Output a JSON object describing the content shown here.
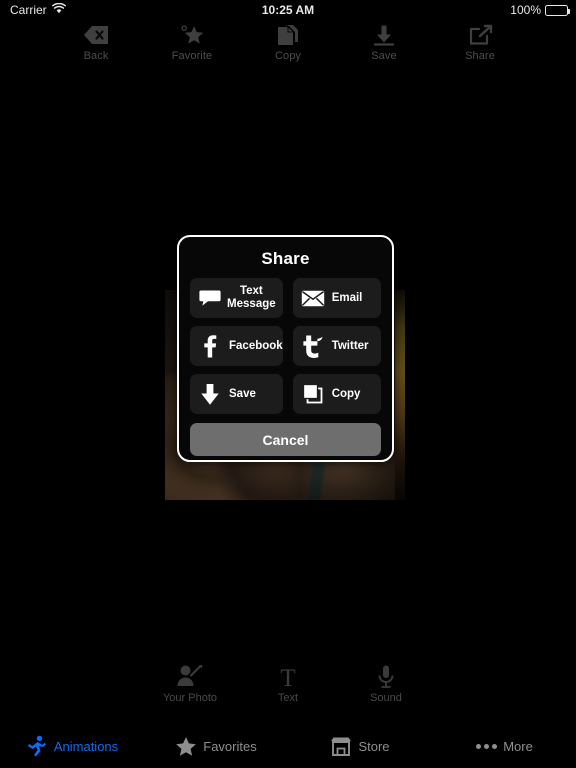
{
  "status_bar": {
    "carrier": "Carrier",
    "wifi_icon": "wifi-icon",
    "time": "10:25 AM",
    "battery_percent": "100%",
    "battery_icon": "battery-full-icon"
  },
  "top_toolbar": {
    "items": [
      {
        "label": "Back",
        "icon": "back-x-icon"
      },
      {
        "label": "Favorite",
        "icon": "star-plus-icon"
      },
      {
        "label": "Copy",
        "icon": "copy-pages-icon"
      },
      {
        "label": "Save",
        "icon": "download-arrow-icon"
      },
      {
        "label": "Share",
        "icon": "share-export-icon"
      }
    ]
  },
  "share_dialog": {
    "title": "Share",
    "options": [
      {
        "label": "Text\nMessage",
        "label_line1": "Text",
        "label_line2": "Message",
        "icon": "speech-bubble-icon"
      },
      {
        "label": "Email",
        "icon": "envelope-icon"
      },
      {
        "label": "Facebook",
        "icon": "facebook-icon"
      },
      {
        "label": "Twitter",
        "icon": "twitter-bird-icon"
      },
      {
        "label": "Save",
        "icon": "down-arrow-icon"
      },
      {
        "label": "Copy",
        "icon": "copy-squares-icon"
      }
    ],
    "cancel_label": "Cancel"
  },
  "edit_toolbar": {
    "items": [
      {
        "label": "Your Photo",
        "icon": "person-pencil-icon"
      },
      {
        "label": "Text",
        "icon": "letter-t-icon"
      },
      {
        "label": "Sound",
        "icon": "microphone-icon"
      }
    ]
  },
  "tab_bar": {
    "items": [
      {
        "label": "Animations",
        "icon": "running-person-icon",
        "active": true
      },
      {
        "label": "Favorites",
        "icon": "star-icon",
        "active": false
      },
      {
        "label": "Store",
        "icon": "storefront-icon",
        "active": false
      },
      {
        "label": "More",
        "icon": "ellipsis-icon",
        "active": false
      }
    ]
  },
  "colors": {
    "background": "#000000",
    "dialog_background": "#070707",
    "dialog_border": "#ffffff",
    "button_background": "#1c1c1c",
    "cancel_background": "#6e6e6e",
    "accent": "#0b6cf5",
    "inactive": "#8e8e8e",
    "toolbar_dim": "#4a4a4a"
  }
}
